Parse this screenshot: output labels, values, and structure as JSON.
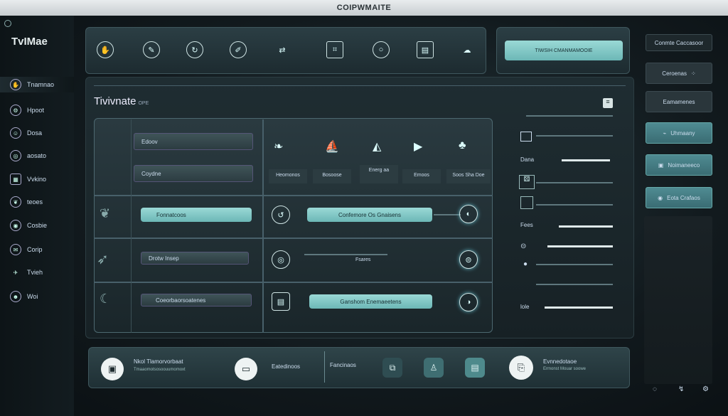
{
  "window": {
    "title": "COIPWMAITE"
  },
  "sidebar": {
    "logo": "TvIMae",
    "items": [
      {
        "label": "Tnamnao",
        "icon": "hand-icon"
      },
      {
        "label": "Hpoot",
        "icon": "gear-icon"
      },
      {
        "label": "Dosa",
        "icon": "smile-icon"
      },
      {
        "label": "aosato",
        "icon": "globe-icon"
      },
      {
        "label": "Vvkino",
        "icon": "calendar-icon"
      },
      {
        "label": "teoes",
        "icon": "leaf-icon"
      },
      {
        "label": "Cosbie",
        "icon": "target-icon"
      },
      {
        "label": "Corip",
        "icon": "chat-icon"
      },
      {
        "label": "Tvieh",
        "icon": "plane-icon"
      },
      {
        "label": "Woi",
        "icon": "robot-icon"
      }
    ]
  },
  "toolbar": {
    "icons": [
      "hand-icon",
      "edit-icon",
      "refresh-icon",
      "brush-icon",
      "share-icon",
      "crop-icon",
      "circle-icon",
      "doc-icon",
      "cloud-icon"
    ],
    "search_value": "TIWSIH CMANMAMOOIE"
  },
  "main": {
    "title": "Tivivnate",
    "title_suffix": "OPE",
    "rows_left": [
      "Edoov",
      "Coydne"
    ],
    "tiles": [
      {
        "label": "Heomonos",
        "icon": "bird-icon"
      },
      {
        "label": "Bosoose",
        "icon": "boat-icon"
      },
      {
        "label": "Energ aa",
        "icon": "chart-icon"
      },
      {
        "label": "Emoos",
        "icon": "play-icon"
      },
      {
        "label": "Soos Sha Doe",
        "icon": "tree-icon"
      }
    ],
    "actions": [
      {
        "left": "Fonnatcoos",
        "right": "Confemore Os Gnaisens"
      },
      {
        "left": "Drotw Insep",
        "right": "Fsares"
      },
      {
        "left": "Coeorbaorsoatenes",
        "right": "Ganshom Enemaeetens"
      }
    ]
  },
  "right_panel": {
    "labels": [
      "Dana",
      "Fees",
      "lole"
    ],
    "buttons": [
      {
        "label": "Conmte Caccasoor",
        "teal": false
      },
      {
        "label": "Ceroenas",
        "teal": false
      },
      {
        "label": "Eamamenes",
        "teal": false
      },
      {
        "label": "Uhmaany",
        "teal": true
      },
      {
        "label": "Noimaneeco",
        "teal": true
      },
      {
        "label": "Eota Crafaos",
        "teal": true
      }
    ],
    "sliders": [
      0.6,
      0.55,
      0.45,
      0.4,
      0.3,
      0.2,
      0.15
    ]
  },
  "bottom": {
    "title": "Nkol Tlamorvorbaat",
    "subtitle": "Tmaaomotsosoouumomoxt",
    "mid": "Eatedinoos",
    "tab": "Fancinaos",
    "end_title": "Evnnedotaoe",
    "end_sub": "Ermonst Mouar soowe"
  },
  "colors": {
    "accent": "#7fc8c6",
    "panel": "#24363b"
  }
}
